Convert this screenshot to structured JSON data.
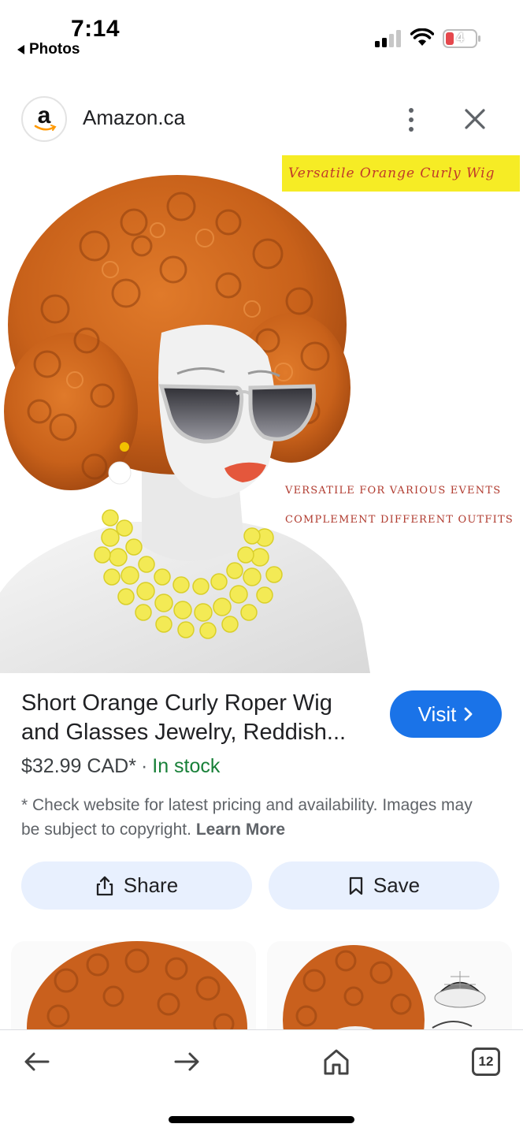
{
  "status_bar": {
    "time": "7:14",
    "back_app": "Photos",
    "battery": "4"
  },
  "site": {
    "name": "Amazon.ca",
    "favicon_letter": "a",
    "more_icon": "more-vert-icon",
    "close_icon": "close-icon"
  },
  "image": {
    "banner_text": "Versatile Orange Curly Wig",
    "overlay_line_1": "VERSATILE FOR VARIOUS EVENTS",
    "overlay_line_2": "COMPLEMENT DIFFERENT OUTFITS"
  },
  "product": {
    "title": "Short Orange Curly Roper Wig and Glasses Jewelry, Reddish...",
    "price": "$32.99 CAD*",
    "separator": "·",
    "stock": "In stock",
    "disclaimer": "* Check website for latest pricing and availability. Images may be subject to copyright.",
    "learn_more": "Learn More"
  },
  "actions": {
    "visit_label": "Visit",
    "share_label": "Share",
    "save_label": "Save"
  },
  "bottom_nav": {
    "tab_count": "12"
  },
  "colors": {
    "accent": "#1a73e8",
    "stock": "#188038",
    "action_bg": "#e8f0fe",
    "hair": "#d2691e",
    "banner": "#f6ec25"
  }
}
